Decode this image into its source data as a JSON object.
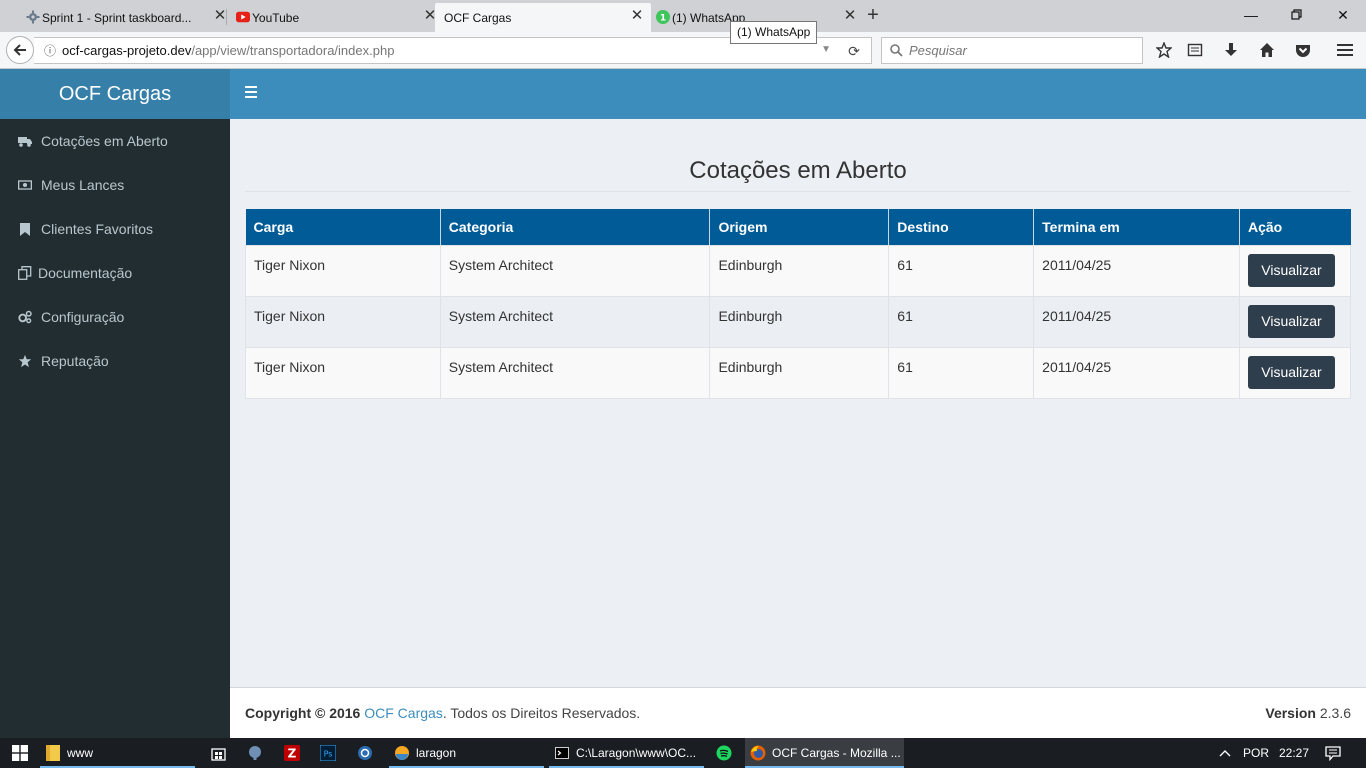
{
  "browser": {
    "tabs": [
      {
        "label": "Sprint 1 - Sprint taskboard..."
      },
      {
        "label": "YouTube"
      },
      {
        "label": "OCF Cargas"
      },
      {
        "label": "(1) WhatsApp",
        "badge": "1"
      }
    ],
    "tooltip": "(1) WhatsApp",
    "url_host": "ocf-cargas-projeto.dev",
    "url_path": "/app/view/transportadora/index.php",
    "search_placeholder": "Pesquisar"
  },
  "app": {
    "brand": "OCF Cargas",
    "sidebar": [
      {
        "label": "Cotações em Aberto",
        "icon": "truck-icon"
      },
      {
        "label": "Meus Lances",
        "icon": "money-icon"
      },
      {
        "label": "Clientes Favoritos",
        "icon": "bookmark-icon"
      },
      {
        "label": "Documentação",
        "icon": "files-icon"
      },
      {
        "label": "Configuração",
        "icon": "cogs-icon"
      },
      {
        "label": "Reputação",
        "icon": "star-icon"
      }
    ],
    "page_title": "Cotações em Aberto",
    "table": {
      "headers": [
        "Carga",
        "Categoria",
        "Origem",
        "Destino",
        "Termina em",
        "Ação"
      ],
      "rows": [
        {
          "carga": "Tiger Nixon",
          "categoria": "System Architect",
          "origem": "Edinburgh",
          "destino": "61",
          "termina": "2011/04/25",
          "acao": "Visualizar"
        },
        {
          "carga": "Tiger Nixon",
          "categoria": "System Architect",
          "origem": "Edinburgh",
          "destino": "61",
          "termina": "2011/04/25",
          "acao": "Visualizar"
        },
        {
          "carga": "Tiger Nixon",
          "categoria": "System Architect",
          "origem": "Edinburgh",
          "destino": "61",
          "termina": "2011/04/25",
          "acao": "Visualizar"
        }
      ]
    },
    "footer": {
      "copyright": "Copyright © 2016",
      "brand": "OCF Cargas",
      "rights": ". Todos os Direitos Reservados.",
      "version_label": "Version",
      "version_value": "2.3.6"
    }
  },
  "taskbar": {
    "items": [
      {
        "label": "www"
      },
      {
        "label": "laragon"
      },
      {
        "label": "C:\\Laragon\\www\\OC..."
      },
      {
        "label": "OCF Cargas - Mozilla ..."
      }
    ],
    "language": "POR",
    "time": "22:27"
  },
  "colors": {
    "header": "#3c8dbc",
    "brand_bg": "#367fa9",
    "sidebar": "#222d32",
    "table_header": "#005b96",
    "button": "#2f3e4d"
  }
}
